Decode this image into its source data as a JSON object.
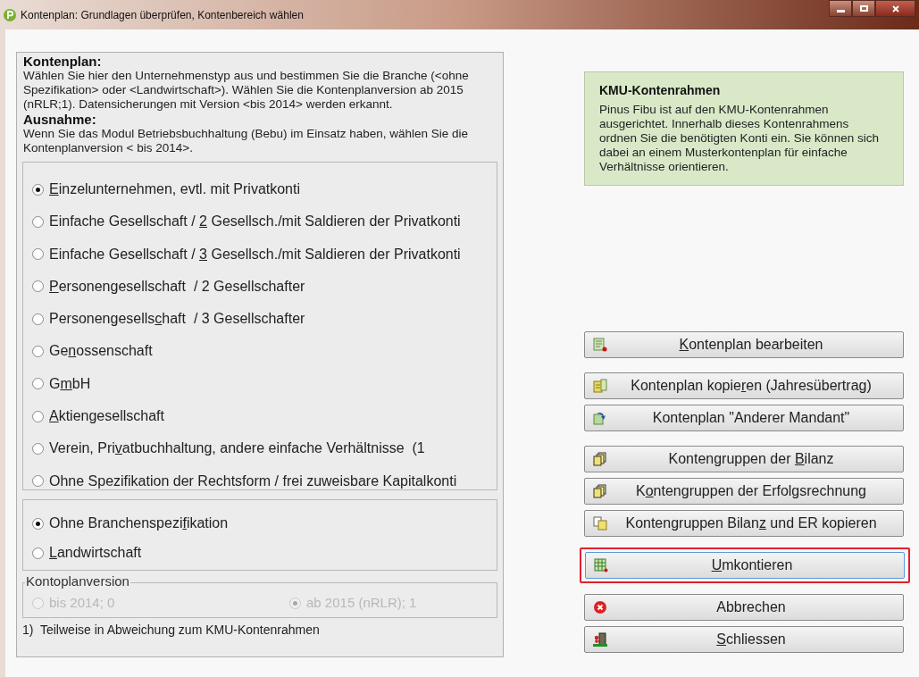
{
  "window": {
    "title": "Kontenplan: Grundlagen überprüfen, Kontenbereich wählen"
  },
  "intro": [
    {
      "heading": "Kontenplan:",
      "text": "Wählen Sie hier den Unternehmenstyp aus und bestimmen Sie die Branche (<ohne Spezifikation> oder <Landwirtschaft>). Wählen Sie die Kontenplanversion ab 2015 (nRLR;1). Datensicherungen mit Version <bis 2014> werden erkannt."
    },
    {
      "heading": "Ausnahme:",
      "text": "Wenn Sie das Modul Betriebsbuchhaltung (Bebu) im Einsatz haben, wählen Sie die Kontenplanversion < bis 2014>."
    }
  ],
  "company_types": [
    {
      "key": "E",
      "post": "inzelunternehmen, evtl. mit Privatkonti",
      "selected": true
    },
    {
      "pre": "Einfache Gesellschaft / ",
      "key": "2",
      "post": " Gesellsch./mit Saldieren der Privatkonti",
      "selected": false
    },
    {
      "pre": "Einfache Gesellschaft / ",
      "key": "3",
      "post": " Gesellsch./mit Saldieren der Privatkonti",
      "selected": false
    },
    {
      "key": "P",
      "post": "ersonengesellschaft  / 2 Gesellschafter",
      "selected": false
    },
    {
      "pre": "Personengesells",
      "key": "c",
      "post": "haft  / 3 Gesellschafter",
      "selected": false
    },
    {
      "pre": "Ge",
      "key": "n",
      "post": "ossenschaft",
      "selected": false
    },
    {
      "pre": "G",
      "key": "m",
      "post": "bH",
      "selected": false
    },
    {
      "key": "A",
      "post": "ktiengesellschaft",
      "selected": false
    },
    {
      "pre": "Verein, Pri",
      "key": "v",
      "post": "atbuchhaltung, andere einfache Verhältnisse  (1",
      "selected": false
    },
    {
      "pre": "Ohne Spezifikation der Rechtsform / frei zuweisbare Kapitalkonti",
      "selected": false
    }
  ],
  "branches": [
    {
      "pre": "Ohne Branchenspezi",
      "key": "f",
      "post": "ikation",
      "selected": true
    },
    {
      "key": "L",
      "post": "andwirtschaft",
      "selected": false
    }
  ],
  "version": {
    "legend": "Kontoplanversion",
    "disabled": true,
    "options": [
      {
        "label": "bis 2014; 0",
        "selected": false
      },
      {
        "label": "ab 2015 (nRLR); 1",
        "selected": true
      }
    ]
  },
  "footnote": "1)  Teilweise in Abweichung zum KMU-Kontenrahmen",
  "info": {
    "title": "KMU-Kontenrahmen",
    "text": "Pinus Fibu ist auf den KMU-Kontenrahmen ausgerichtet. Innerhalb dieses Kontenrahmens ordnen Sie die benötigten Konti ein. Sie können sich dabei an einem Musterkontenplan für einfache Verhältnisse orientieren."
  },
  "button_groups": [
    [
      {
        "key": "K",
        "post": "ontenplan bearbeiten",
        "kind": "edit",
        "highlighted": false
      }
    ],
    [
      {
        "pre": "Kontenplan kopie",
        "key": "r",
        "post": "en (Jahresübertrag)",
        "kind": "copy",
        "highlighted": false
      },
      {
        "pre": "Kontenplan \"Anderer Mandant\"",
        "kind": "import",
        "highlighted": false
      }
    ],
    [
      {
        "pre": "Kontengruppen der ",
        "key": "B",
        "post": "ilanz",
        "kind": "groups",
        "highlighted": false
      },
      {
        "pre": "K",
        "key": "o",
        "post": "ntengruppen der Erfolgsrechnung",
        "kind": "groups",
        "highlighted": false
      },
      {
        "pre": "Kontengruppen Bilan",
        "key": "z",
        "post": " und ER kopieren",
        "kind": "duplicate",
        "highlighted": false
      }
    ],
    [
      {
        "key": "U",
        "post": "mkontieren",
        "kind": "rebook",
        "highlighted": true
      }
    ],
    [
      {
        "pre": "Abbrechen",
        "kind": "cancel",
        "highlighted": false
      },
      {
        "key": "S",
        "post": "chliessen",
        "kind": "close",
        "highlighted": false
      }
    ]
  ]
}
